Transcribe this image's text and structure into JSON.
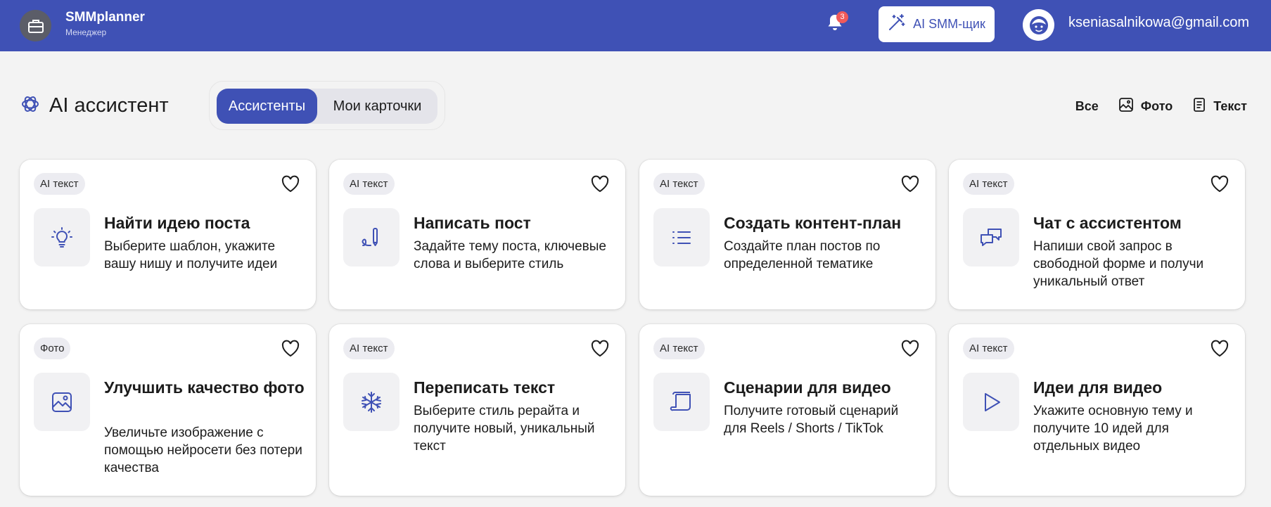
{
  "header": {
    "brand_name": "SMMplanner",
    "brand_role": "Менеджер",
    "notifications_count": "3",
    "ai_button_label": "AI SMM-щик",
    "user_email": "kseniasalnikowa@gmail.com",
    "accent_color": "#3f51b5"
  },
  "toolbar": {
    "page_title": "AI ассистент",
    "tabs": [
      {
        "label": "Ассистенты",
        "active": true
      },
      {
        "label": "Мои карточки",
        "active": false
      }
    ],
    "filters": [
      {
        "label": "Все",
        "icon": ""
      },
      {
        "label": "Фото",
        "icon": "image-icon"
      },
      {
        "label": "Текст",
        "icon": "document-icon"
      }
    ]
  },
  "cards": [
    {
      "tag": "AI текст",
      "icon": "lightbulb-icon",
      "title": "Найти идею поста",
      "description": "Выберите шаблон, укажите вашу нишу и получите идеи"
    },
    {
      "tag": "AI текст",
      "icon": "pen-icon",
      "title": "Написать пост",
      "description": "Задайте тему поста, ключевые слова и выберите стиль"
    },
    {
      "tag": "AI текст",
      "icon": "list-icon",
      "title": "Создать контент-план",
      "description": "Создайте план постов по определенной тематике"
    },
    {
      "tag": "AI текст",
      "icon": "chat-icon",
      "title": "Чат с ассистентом",
      "description": "Напиши свой запрос в свободной форме и получи уникальный ответ"
    },
    {
      "tag": "Фото",
      "icon": "image-icon",
      "title": "Улучшить качество фото",
      "description": "Увеличьте изображение с помощью нейросети без потери качества"
    },
    {
      "tag": "AI текст",
      "icon": "snowflake-icon",
      "title": "Переписать текст",
      "description": "Выберите стиль рерайта и получите новый, уникальный текст"
    },
    {
      "tag": "AI текст",
      "icon": "script-icon",
      "title": "Сценарии для видео",
      "description": "Получите готовый сценарий для Reels / Shorts / TikTok"
    },
    {
      "tag": "AI текст",
      "icon": "play-icon",
      "title": "Идеи для видео",
      "description": "Укажите основную тему и получите 10 идей для отдельных видео"
    }
  ]
}
